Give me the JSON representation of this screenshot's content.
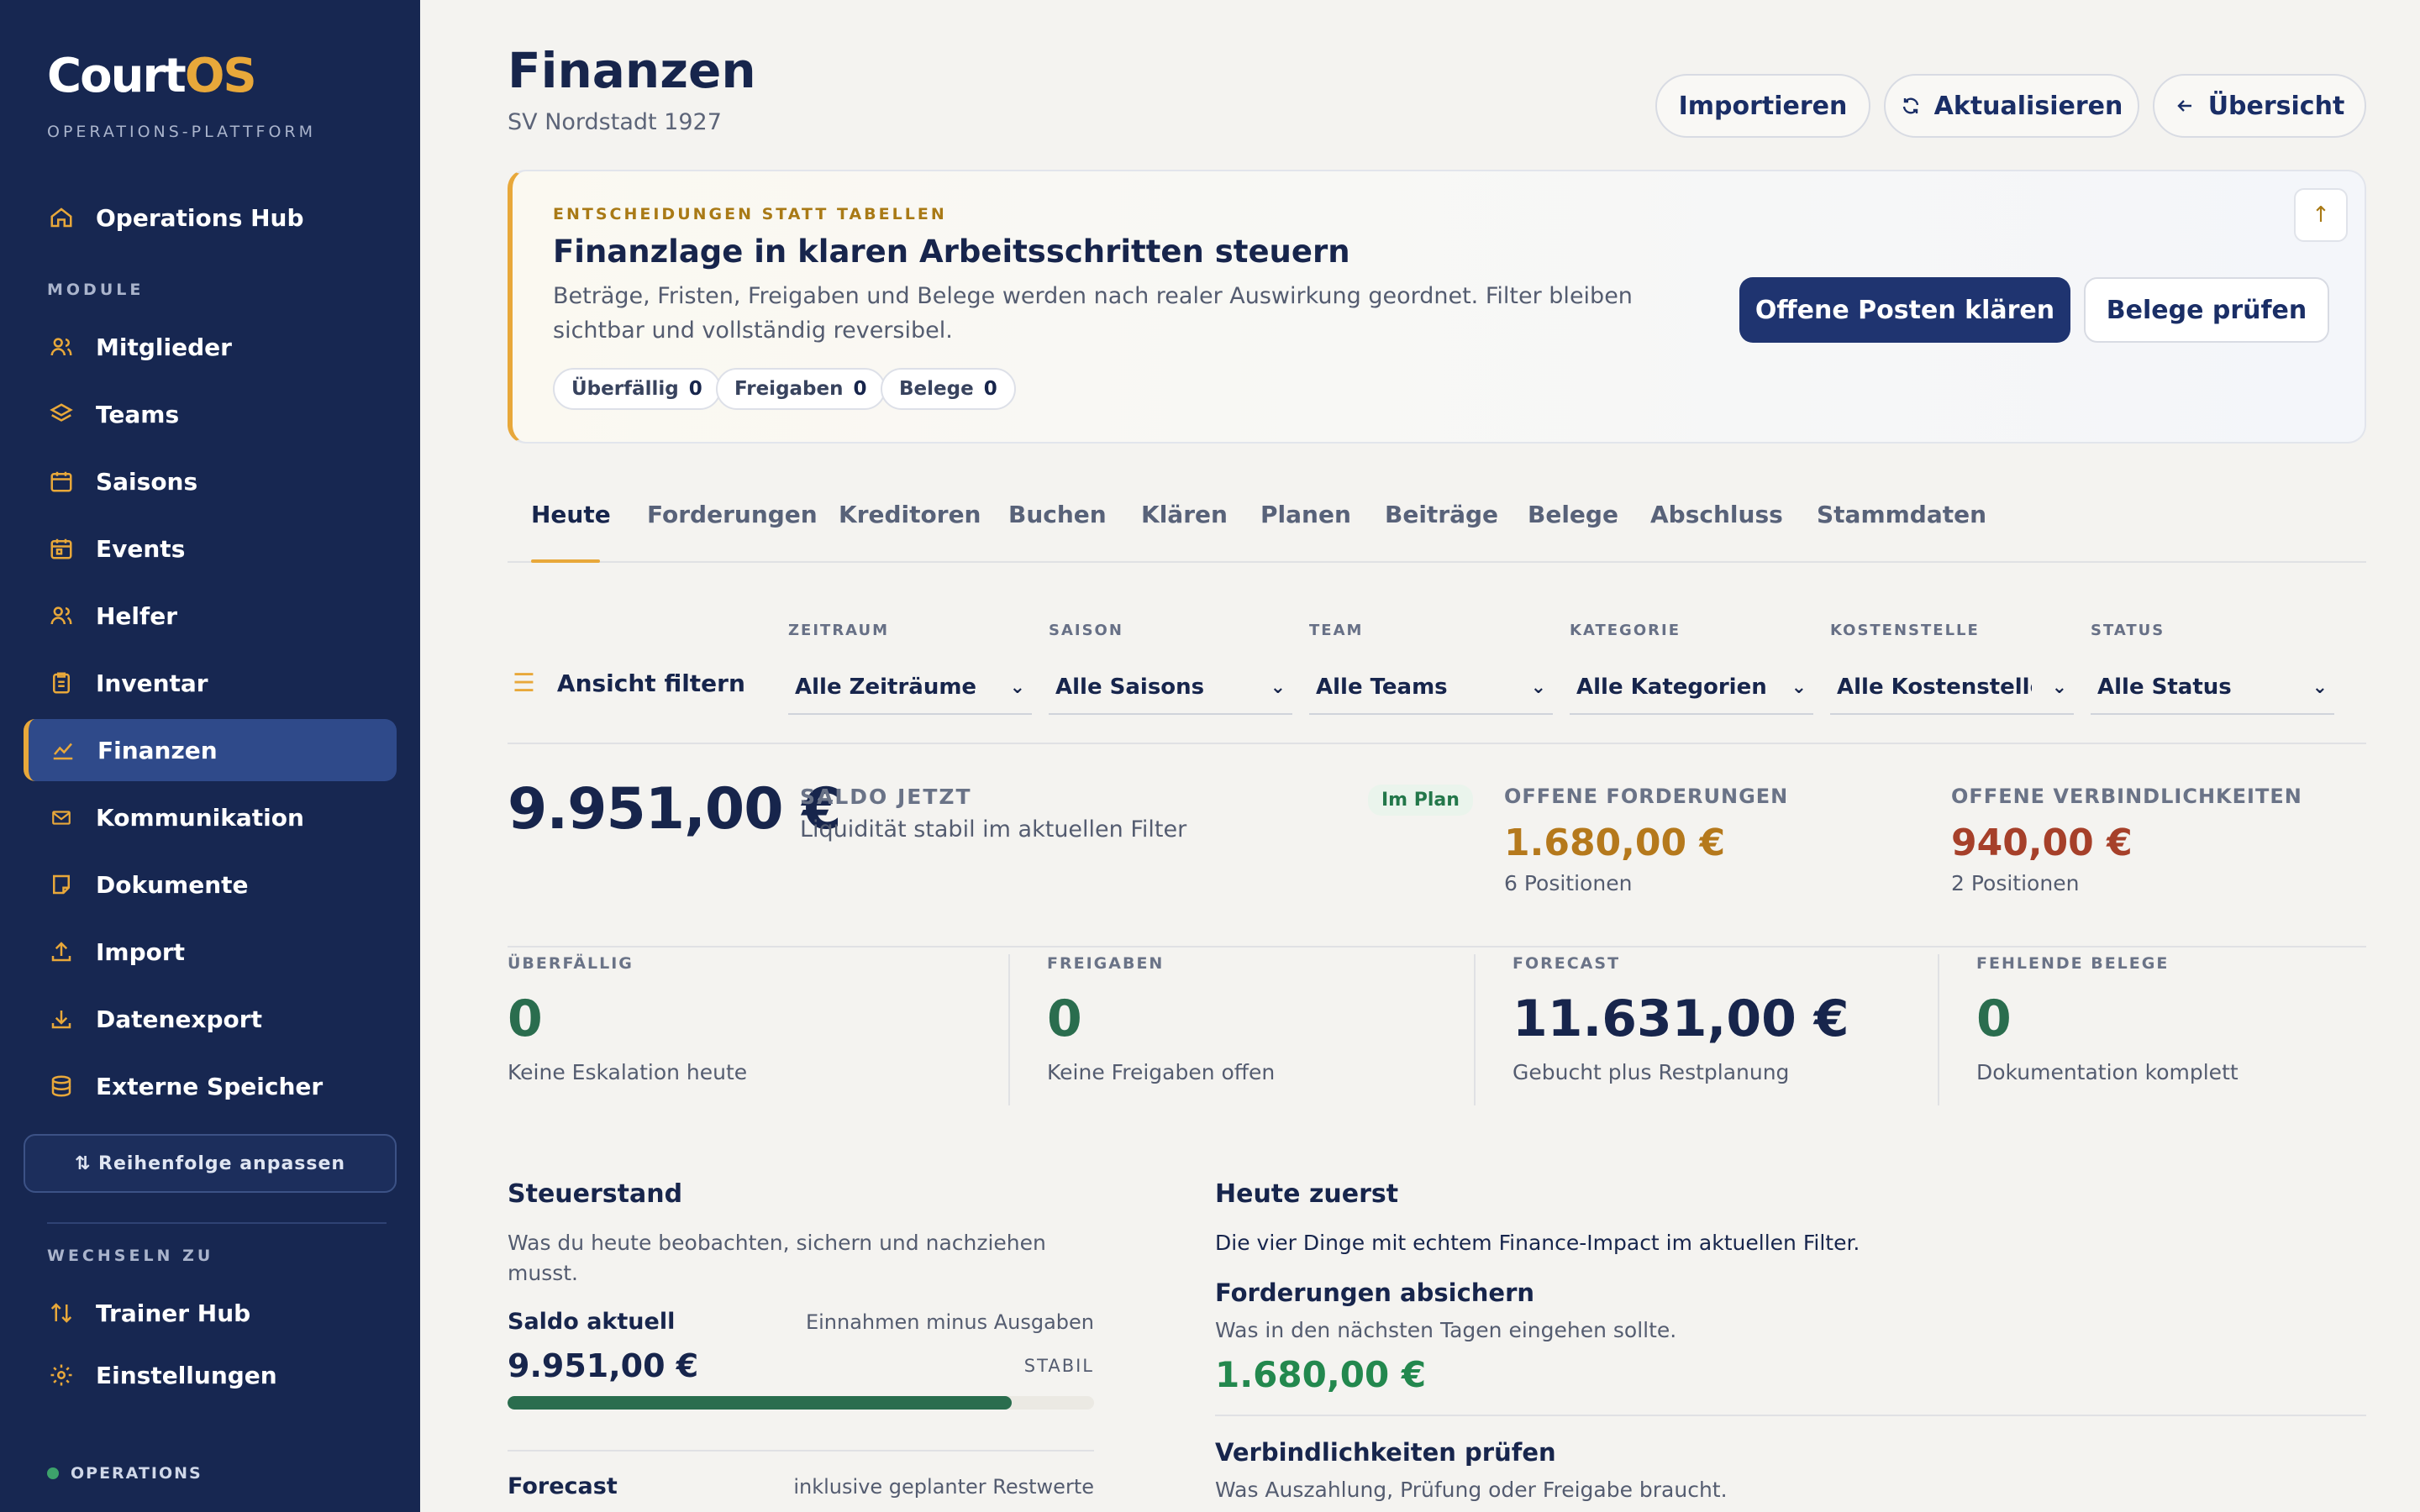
{
  "app": {
    "name_main": "Court",
    "name_accent": "OS",
    "tagline": "OPERATIONS-PLATTFORM"
  },
  "sidebar": {
    "top_item": {
      "label": "Operations Hub",
      "icon": "home-icon"
    },
    "module_heading": "MODULE",
    "items": [
      {
        "label": "Mitglieder",
        "icon": "users-icon"
      },
      {
        "label": "Teams",
        "icon": "layers-icon"
      },
      {
        "label": "Saisons",
        "icon": "calendar-icon"
      },
      {
        "label": "Events",
        "icon": "calendar-event-icon"
      },
      {
        "label": "Helfer",
        "icon": "helpers-icon"
      },
      {
        "label": "Inventar",
        "icon": "clipboard-icon"
      },
      {
        "label": "Finanzen",
        "icon": "chart-line-icon"
      },
      {
        "label": "Kommunikation",
        "icon": "mail-icon"
      },
      {
        "label": "Dokumente",
        "icon": "document-icon"
      },
      {
        "label": "Import",
        "icon": "upload-icon"
      },
      {
        "label": "Datenexport",
        "icon": "download-icon"
      },
      {
        "label": "Externe Speicher",
        "icon": "database-icon"
      }
    ],
    "active_item": "Finanzen",
    "reorder_label": "⇅ Reihenfolge anpassen",
    "switch_heading": "WECHSELN ZU",
    "switch_items": [
      {
        "label": "Trainer Hub",
        "icon": "swap-icon"
      },
      {
        "label": "Einstellungen",
        "icon": "gear-icon"
      }
    ],
    "footer_status": "OPERATIONS"
  },
  "header": {
    "title": "Finanzen",
    "subtitle": "SV Nordstadt 1927",
    "buttons": {
      "import": "Importieren",
      "refresh": "Aktualisieren",
      "overview": "Übersicht"
    }
  },
  "banner": {
    "eyebrow": "ENTSCHEIDUNGEN STATT TABELLEN",
    "title": "Finanzlage in klaren Arbeitsschritten steuern",
    "description": "Beträge, Fristen, Freigaben und Belege werden nach realer Auswirkung geordnet. Filter bleiben sichtbar und vollständig reversibel.",
    "chips": [
      {
        "label": "Überfällig",
        "count": "0"
      },
      {
        "label": "Freigaben",
        "count": "0"
      },
      {
        "label": "Belege",
        "count": "0"
      }
    ],
    "primary_action": "Offene Posten klären",
    "secondary_action": "Belege prüfen"
  },
  "tabs": [
    "Heute",
    "Forderungen",
    "Kreditoren",
    "Buchen",
    "Klären",
    "Planen",
    "Beiträge",
    "Belege",
    "Abschluss",
    "Stammdaten"
  ],
  "active_tab": "Heute",
  "filters": {
    "label": "Ansicht filtern",
    "fields": [
      {
        "label": "ZEITRAUM",
        "value": "Alle Zeiträume"
      },
      {
        "label": "SAISON",
        "value": "Alle Saisons"
      },
      {
        "label": "TEAM",
        "value": "Alle Teams"
      },
      {
        "label": "KATEGORIE",
        "value": "Alle Kategorien"
      },
      {
        "label": "KOSTENSTELLE",
        "value": "Alle Kostenstellen"
      },
      {
        "label": "STATUS",
        "value": "Alle Status"
      }
    ]
  },
  "saldo": {
    "amount": "9.951,00 €",
    "label": "SALDO JETZT",
    "description": "Liquidität stabil im aktuellen Filter",
    "badge": "Im Plan"
  },
  "receivables": {
    "label": "OFFENE FORDERUNGEN",
    "amount": "1.680,00 €",
    "sub": "6 Positionen",
    "color": "#b5791c"
  },
  "payables": {
    "label": "OFFENE VERBINDLICHKEITEN",
    "amount": "940,00 €",
    "sub": "2 Positionen",
    "color": "#a6402a"
  },
  "stats": [
    {
      "label": "ÜBERFÄLLIG",
      "value": "0",
      "sub": "Keine Eskalation heute"
    },
    {
      "label": "FREIGABEN",
      "value": "0",
      "sub": "Keine Freigaben offen"
    },
    {
      "label": "FORECAST",
      "value": "11.631,00 €",
      "sub": "Gebucht plus Restplanung"
    },
    {
      "label": "FEHLENDE BELEGE",
      "value": "0",
      "sub": "Dokumentation komplett"
    }
  ],
  "steuerstand": {
    "title": "Steuerstand",
    "description": "Was du heute beobachten, sichern und nachziehen musst.",
    "rows": [
      {
        "label": "Saldo aktuell",
        "hint": "Einnahmen minus Ausgaben",
        "value": "9.951,00 €",
        "status": "STABIL",
        "progress": 0.86
      },
      {
        "label": "Forecast",
        "hint": "inklusive geplanter Restwerte"
      }
    ]
  },
  "heute_zuerst": {
    "title": "Heute zuerst",
    "description": "Die vier Dinge mit echtem Finance-Impact im aktuellen Filter.",
    "items": [
      {
        "title": "Forderungen absichern",
        "description": "Was in den nächsten Tagen eingehen sollte.",
        "amount": "1.680,00 €"
      },
      {
        "title": "Verbindlichkeiten prüfen",
        "description": "Was Auszahlung, Prüfung oder Freigabe braucht."
      }
    ]
  },
  "colors": {
    "sidebar": "#172751",
    "accent": "#e8a83a",
    "primary": "#1f3470",
    "positive": "#2a6d4e",
    "positive_amount": "#23884e"
  }
}
